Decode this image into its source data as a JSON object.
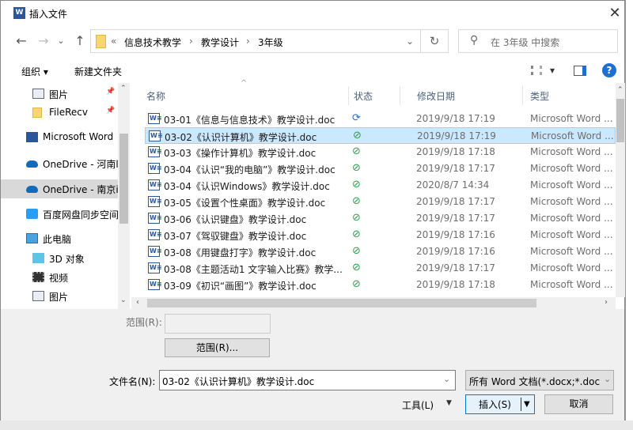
{
  "window": {
    "title": "插入文件",
    "close_icon": "close-icon"
  },
  "nav": {
    "back": "←",
    "forward": "→",
    "recent": "⌄",
    "up": "↑"
  },
  "address": {
    "overflow": "«",
    "crumbs": [
      "信息技术教学",
      "教学设计",
      "3年级"
    ],
    "sep": "›",
    "dropdown": "⌄",
    "refresh": "↻"
  },
  "search": {
    "placeholder": "在 3年级 中搜索",
    "icon": "⚲"
  },
  "toolbar": {
    "organize": "组织 ▾",
    "new_folder": "新建文件夹",
    "view_arrow": "▾",
    "help": "?"
  },
  "sidebar": {
    "items": [
      {
        "label": "图片",
        "icon": "pictures-icon",
        "pinned": true
      },
      {
        "label": "FileRecv",
        "icon": "folder-icon",
        "pinned": true
      },
      {
        "label": "Microsoft Word",
        "icon": "word-icon"
      },
      {
        "label": "OneDrive - 河南l",
        "icon": "onedrive-icon"
      },
      {
        "label": "OneDrive - 南京i",
        "icon": "onedrive-icon",
        "selected": true
      },
      {
        "label": "百度网盘同步空间",
        "icon": "baidu-icon"
      },
      {
        "label": "此电脑",
        "icon": "computer-icon"
      },
      {
        "label": "3D 对象",
        "icon": "3d-icon"
      },
      {
        "label": "视频",
        "icon": "video-icon"
      },
      {
        "label": "图片",
        "icon": "pictures-icon"
      }
    ]
  },
  "columns": {
    "name": "名称",
    "status": "状态",
    "date": "修改日期",
    "type": "类型"
  },
  "files": [
    {
      "name": "03-01《信息与信息技术》教学设计.doc",
      "status": "sync",
      "date": "2019/9/18 17:19",
      "type": "Microsoft Word ..."
    },
    {
      "name": "03-02《认识计算机》教学设计.doc",
      "status": "ok",
      "date": "2019/9/18 17:19",
      "type": "Microsoft Word ...",
      "selected": true
    },
    {
      "name": "03-03《操作计算机》教学设计.doc",
      "status": "ok",
      "date": "2019/9/18 17:18",
      "type": "Microsoft Word ..."
    },
    {
      "name": "03-04《认识“我的电脑”》教学设计.doc",
      "status": "ok",
      "date": "2019/9/18 17:17",
      "type": "Microsoft Word ..."
    },
    {
      "name": "03-04《认识Windows》教学设计.doc",
      "status": "ok",
      "date": "2020/8/7 14:34",
      "type": "Microsoft Word ..."
    },
    {
      "name": "03-05《设置个性桌面》教学设计.doc",
      "status": "ok",
      "date": "2019/9/18 17:17",
      "type": "Microsoft Word ..."
    },
    {
      "name": "03-06《认识键盘》教学设计.doc",
      "status": "ok",
      "date": "2019/9/18 17:17",
      "type": "Microsoft Word ..."
    },
    {
      "name": "03-07《驾驭键盘》教学设计.doc",
      "status": "ok",
      "date": "2019/9/18 17:16",
      "type": "Microsoft Word ..."
    },
    {
      "name": "03-08《用键盘打字》教学设计.doc",
      "status": "ok",
      "date": "2019/9/18 17:16",
      "type": "Microsoft Word ..."
    },
    {
      "name": "03-08《主题活动1 文字输入比赛》教学...",
      "status": "ok",
      "date": "2019/9/18 17:17",
      "type": "Microsoft Word ..."
    },
    {
      "name": "03-09《初识“画图”》教学设计.doc",
      "status": "ok",
      "date": "2019/9/18 17:18",
      "type": "Microsoft Word ..."
    }
  ],
  "range": {
    "label": "范围(R):",
    "value": "",
    "button": "范围(R)..."
  },
  "filename": {
    "label": "文件名(N):",
    "value": "03-02《认识计算机》教学设计.doc"
  },
  "filetype": {
    "value": "所有 Word 文档(*.docx;*.docı"
  },
  "buttons": {
    "tools": "工具(L)",
    "insert": "插入(S)",
    "cancel": "取消"
  },
  "colors": {
    "selection": "#cce8ff",
    "accent": "#0078d7",
    "ok": "#2e9e4a"
  }
}
